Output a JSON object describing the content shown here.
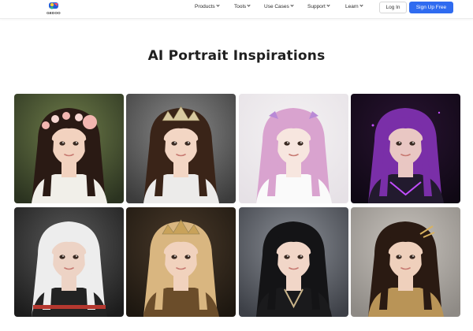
{
  "header": {
    "logo_text": "GEDOO",
    "nav": [
      {
        "label": "Products",
        "name": "nav-products"
      },
      {
        "label": "Tools",
        "name": "nav-tools"
      },
      {
        "label": "Use Cases",
        "name": "nav-use-cases"
      },
      {
        "label": "Support",
        "name": "nav-support"
      },
      {
        "label": "Learn",
        "name": "nav-learn"
      }
    ],
    "login_label": "Log In",
    "signup_label": "Sign Up Free",
    "accent_color": "#2f6bf0"
  },
  "main": {
    "title": "AI Portrait Inspirations",
    "gallery": [
      {
        "name": "portrait-flower-crown-girl",
        "bg": "#6f7d4a",
        "bg2": "#2b3320",
        "hair": "#2a1a14",
        "skin": "#f2d2bf",
        "cloth": "#f1efe9",
        "accent": "#f3b6b0",
        "item": "flower-crown"
      },
      {
        "name": "portrait-tiara-girl",
        "bg": "#8a8a8a",
        "bg2": "#3c3c3c",
        "hair": "#3a2418",
        "skin": "#f3d6c4",
        "cloth": "#ecebea",
        "accent": "#d8c9a0",
        "item": "tiara"
      },
      {
        "name": "portrait-anime-pink-hair-girl",
        "bg": "#f4f2f3",
        "bg2": "#e6e1e6",
        "hair": "#d9a3cf",
        "skin": "#f7e6df",
        "cloth": "#fafafa",
        "accent": "#b98ad6",
        "item": "ribbons"
      },
      {
        "name": "portrait-purple-hair-cyber-girl",
        "bg": "#2a1433",
        "bg2": "#0f0814",
        "hair": "#7a2fa8",
        "skin": "#e9c7c3",
        "cloth": "#221a2e",
        "accent": "#c24dff",
        "item": "armor"
      },
      {
        "name": "portrait-white-hair-woman",
        "bg": "#5b5b5b",
        "bg2": "#1c1c1c",
        "hair": "#ededed",
        "skin": "#edd3c5",
        "cloth": "#232323",
        "accent": "#b5382f",
        "item": "knit"
      },
      {
        "name": "portrait-blonde-crowned-woman",
        "bg": "#4a3a2a",
        "bg2": "#1d1710",
        "hair": "#d9b680",
        "skin": "#f1d2bd",
        "cloth": "#6b4d2a",
        "accent": "#c8a25a",
        "item": "crown"
      },
      {
        "name": "portrait-black-hair-kimono-girl",
        "bg": "#8b8f96",
        "bg2": "#3d4047",
        "hair": "#141416",
        "skin": "#f1d6c8",
        "cloth": "#1a1a1c",
        "accent": "#c9b48a",
        "item": "kimono"
      },
      {
        "name": "portrait-dark-hair-gold-jewelry-woman",
        "bg": "#c8c3bd",
        "bg2": "#8e8a85",
        "hair": "#2a1a12",
        "skin": "#efd0bc",
        "cloth": "#b99457",
        "accent": "#d9b25f",
        "item": "hairpin"
      }
    ]
  }
}
